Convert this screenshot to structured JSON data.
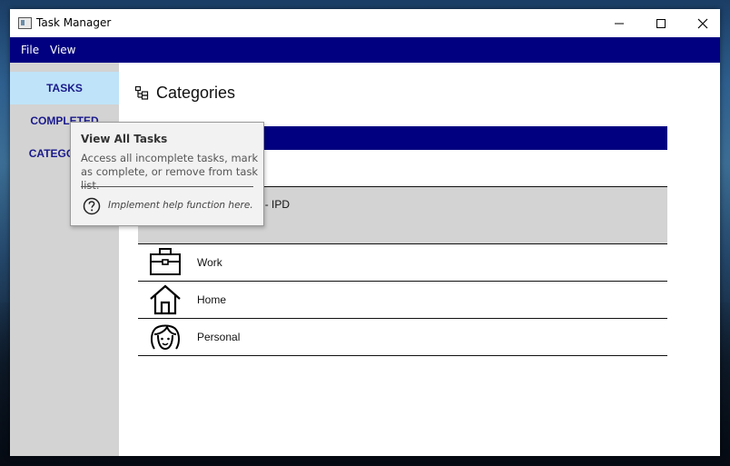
{
  "window": {
    "title": "Task Manager"
  },
  "menu": {
    "items": [
      "File",
      "View"
    ]
  },
  "sidebar": {
    "items": [
      {
        "label": "TASKS",
        "active": true
      },
      {
        "label": "COMPLETED",
        "active": false
      },
      {
        "label": "CATEGORIES",
        "active": false
      }
    ]
  },
  "main": {
    "title": "Categories",
    "title_icon": "category-tree-icon",
    "rows": [
      {
        "label": "",
        "icon": ""
      },
      {
        "label": "Sault College - IPD",
        "icon": "",
        "selected": true
      },
      {
        "label": "Work",
        "icon": "briefcase-icon"
      },
      {
        "label": "Home",
        "icon": "home-icon"
      },
      {
        "label": "Personal",
        "icon": "person-icon"
      }
    ]
  },
  "tooltip": {
    "title": "View All Tasks",
    "body": "Access all incomplete tasks, mark as complete, or remove from task list.",
    "help_icon": "help-circle-icon",
    "help_text": "Implement help function here."
  },
  "colors": {
    "menubar": "#000080",
    "sidebar": "#d3d3d3",
    "active_nav": "#bfe3f8",
    "nav_text": "#1a1a8c",
    "selected_row": "#d3d3d3"
  }
}
